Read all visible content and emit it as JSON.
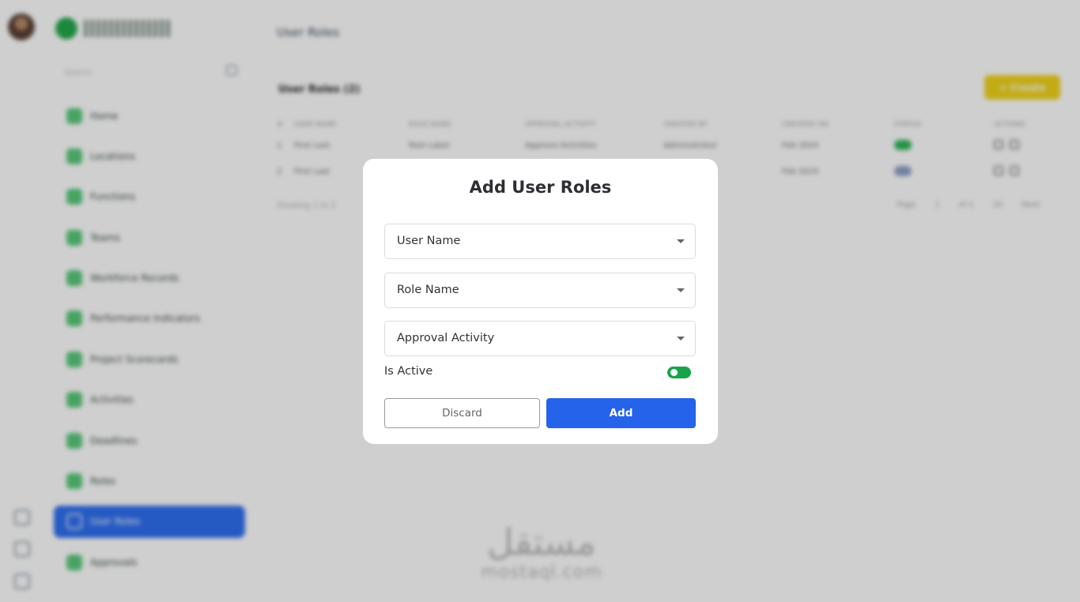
{
  "app": {
    "page_title": "User Roles",
    "search_placeholder": "Search",
    "card_title": "User Roles (2)",
    "create_button": "+ Create",
    "menu": [
      {
        "label": "Home",
        "icon": "home-icon"
      },
      {
        "label": "Locations",
        "icon": "location-icon"
      },
      {
        "label": "Functions",
        "icon": "function-icon"
      },
      {
        "label": "Teams",
        "icon": "team-icon"
      },
      {
        "label": "Workforce Records",
        "icon": "workforce-icon"
      },
      {
        "label": "Performance Indicators",
        "icon": "performance-icon"
      },
      {
        "label": "Project Scorecards",
        "icon": "scorecard-icon"
      },
      {
        "label": "Activities",
        "icon": "activity-icon"
      },
      {
        "label": "Deadlines",
        "icon": "deadline-icon"
      },
      {
        "label": "Roles",
        "icon": "roles-icon"
      },
      {
        "label": "User Roles",
        "icon": "user-roles-icon",
        "active": true
      },
      {
        "label": "Approvals",
        "icon": "approval-icon"
      }
    ],
    "table": {
      "headers": [
        "#",
        "USER NAME",
        "ROLE NAME",
        "APPROVAL ACTIVITY",
        "CREATED BY",
        "CREATED ON",
        "STATUS",
        "ACTIONS"
      ],
      "rows": [
        [
          "1",
          "First Last",
          "Role Label",
          "Approve Activities",
          "Administrator",
          "Feb 2024",
          "active",
          ""
        ],
        [
          "2",
          "First Last",
          "",
          "",
          "",
          "Feb 2024",
          "inactive",
          ""
        ]
      ],
      "footer": "Showing 1 to 2",
      "pager": [
        "Page",
        "1",
        "of 1",
        "10",
        "Next"
      ]
    },
    "watermark": {
      "arabic": "مستقل",
      "latin": "mostaql.com"
    }
  },
  "modal": {
    "title": "Add User Roles",
    "fields": [
      {
        "label": "User Name"
      },
      {
        "label": "Role Name"
      },
      {
        "label": "Approval Activity"
      }
    ],
    "is_active_label": "Is Active",
    "is_active": true,
    "discard_label": "Discard",
    "add_label": "Add",
    "colors": {
      "primary": "#2563eb",
      "toggle_on": "#16a34a"
    }
  }
}
